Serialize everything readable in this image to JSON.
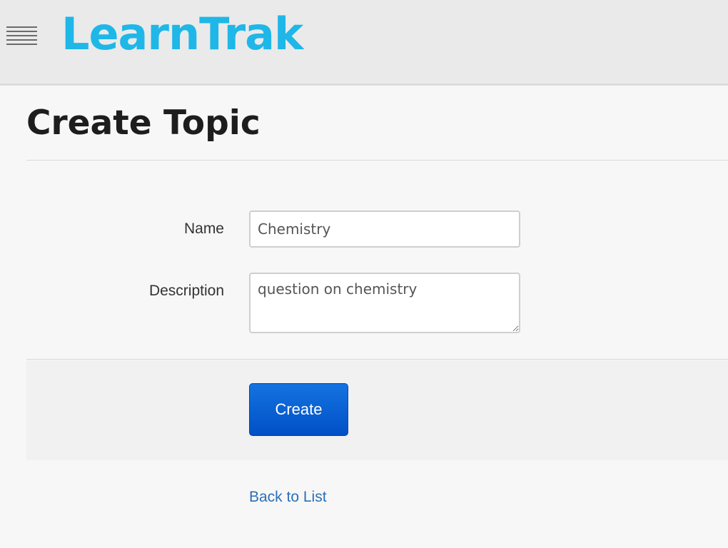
{
  "header": {
    "brand": "LearnTrak",
    "menu_icon": "hamburger-menu-icon",
    "brand_color": "#1eb7e8"
  },
  "page": {
    "title": "Create Topic"
  },
  "form": {
    "name_label": "Name",
    "name_value": "Chemistry",
    "description_label": "Description",
    "description_value": "question on chemistry",
    "create_button": "Create",
    "primary_color": "#0a5fd6"
  },
  "footer": {
    "back_link": "Back to List",
    "link_color": "#2a6fb7"
  }
}
